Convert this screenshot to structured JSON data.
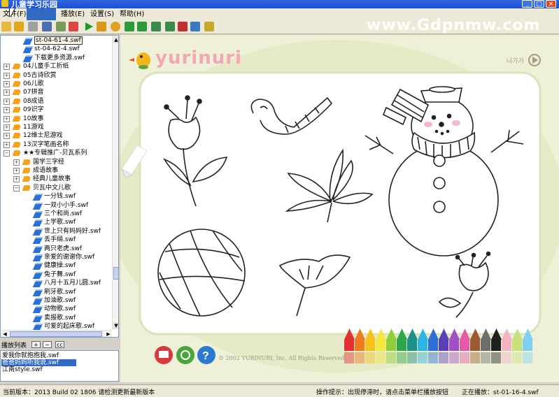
{
  "window": {
    "title": "儿童学习乐园"
  },
  "menu": {
    "file": "文件(F)",
    "play": "播放(E)",
    "settings": "设置(S)",
    "help": "帮助(H)"
  },
  "watermark": "www.Gdpnmw.com",
  "tree": {
    "top_files": [
      "st-04-61-4.swf",
      "st-04-62-4.swf",
      "下载更多资源.swf"
    ],
    "categories": [
      "04儿童手工折纸",
      "05古诗欣赏",
      "06儿歌",
      "07拼音",
      "08成语",
      "09识字",
      "10故事",
      "11游戏",
      "12维士尼游戏",
      "13汉字笔画名称"
    ],
    "special": "★★专辑推广-贝瓦系列",
    "subcategories": [
      "国学三字经",
      "成语故事",
      "经典儿童故事",
      "贝瓦中文儿歌"
    ],
    "songs": [
      "一分钱.swf",
      "一双小小手.swf",
      "三个和尚.swf",
      "上学歌.swf",
      "世上只有妈妈好.swf",
      "丢手绢.swf",
      "两只老虎.swf",
      "亲爱的谢谢你.swf",
      "健康操.swf",
      "兔子舞.swf",
      "八月十五月儿圆.swf",
      "刷牙歌.swf",
      "加油歌.swf",
      "动物歌.swf",
      "卖报歌.swf",
      "可爱的起床歌.swf"
    ]
  },
  "playlist": {
    "label": "播放列表",
    "add": "+",
    "remove": "−",
    "clear": "cc",
    "items": [
      "爱我你就抱抱我.swf",
      "爸爸妈妈听我说.swf",
      "江南style.swf"
    ]
  },
  "flash": {
    "logo": "yurinuri",
    "next": "나가기",
    "copyright": "© 2002 YURINURI, Inc. All Rights Reserved.",
    "crayon_colors": [
      "#e53030",
      "#f07a20",
      "#f5c21c",
      "#f4e640",
      "#8ccf3a",
      "#2aa84a",
      "#1f8f8a",
      "#2cb6e6",
      "#2d6fd6",
      "#5a3fb6",
      "#a24fc3",
      "#e25ba8",
      "#9b5b2e",
      "#6d6d6d",
      "#202020",
      "#f3b3c2",
      "#c7e07c",
      "#7fd0f0"
    ]
  },
  "status": {
    "version": "当前版本：2013 Build 02 1806 请检测更新最新版本",
    "tip": "操作提示：出现停滞时，请点击菜单栏播放按钮",
    "now_playing": "正在播放：st-01-16-4.swf"
  }
}
